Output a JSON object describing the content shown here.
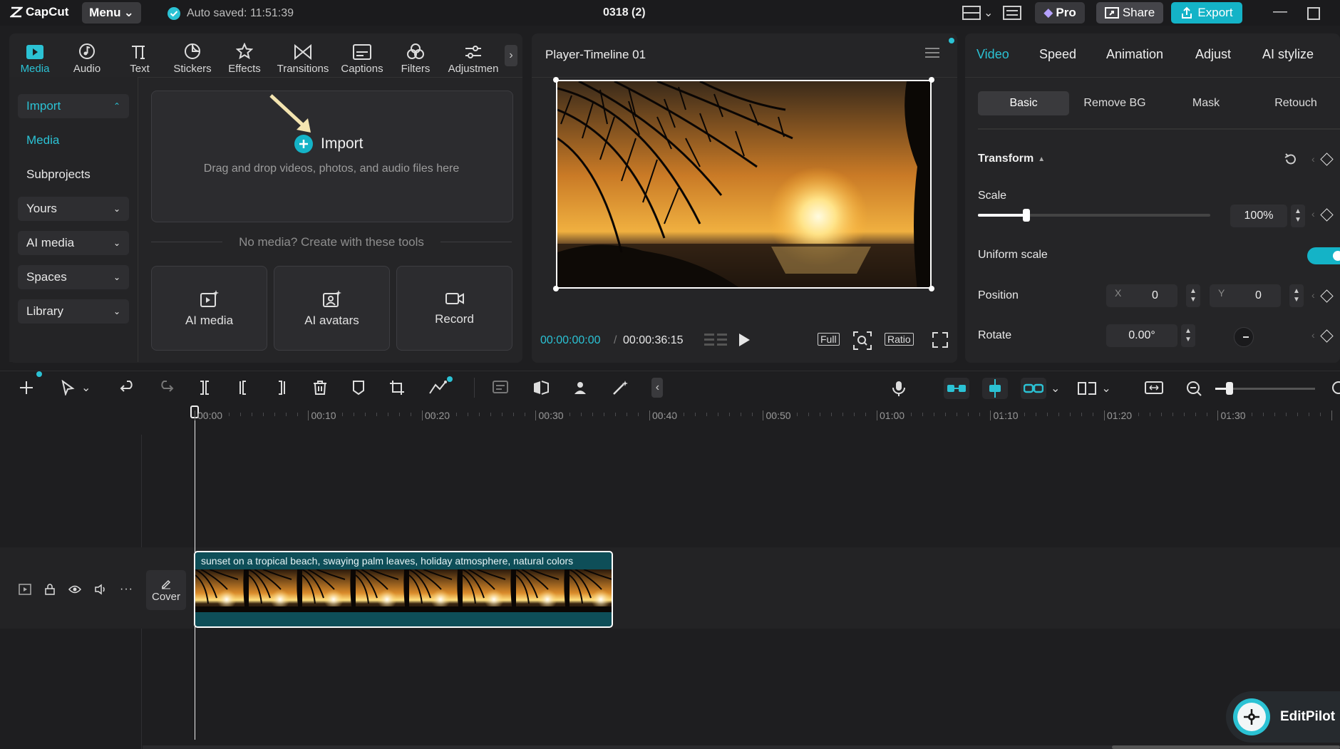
{
  "app": {
    "name": "CapCut",
    "menu_label": "Menu",
    "autosave": "Auto saved: 11:51:39",
    "project_title": "0318 (2)"
  },
  "titlebar": {
    "pro_label": "Pro",
    "share_label": "Share",
    "export_label": "Export"
  },
  "tool_tabs": [
    {
      "label": "Media",
      "icon": "media-icon"
    },
    {
      "label": "Audio",
      "icon": "audio-icon"
    },
    {
      "label": "Text",
      "icon": "text-icon"
    },
    {
      "label": "Stickers",
      "icon": "stickers-icon"
    },
    {
      "label": "Effects",
      "icon": "effects-icon"
    },
    {
      "label": "Transitions",
      "icon": "transitions-icon"
    },
    {
      "label": "Captions",
      "icon": "captions-icon"
    },
    {
      "label": "Filters",
      "icon": "filters-icon"
    },
    {
      "label": "Adjustmen",
      "icon": "adjustment-icon"
    }
  ],
  "sidebar": {
    "items": [
      {
        "label": "Import"
      },
      {
        "label": "Media"
      },
      {
        "label": "Subprojects"
      },
      {
        "label": "Yours"
      },
      {
        "label": "AI media"
      },
      {
        "label": "Spaces"
      },
      {
        "label": "Library"
      }
    ]
  },
  "import_zone": {
    "title": "Import",
    "hint": "Drag and drop videos, photos, and audio files here"
  },
  "tools_divider": "No media? Create with these tools",
  "tool_cards": [
    {
      "label": "AI media"
    },
    {
      "label": "AI avatars"
    },
    {
      "label": "Record"
    }
  ],
  "player": {
    "title": "Player-Timeline 01",
    "current_time": "00:00:00:00",
    "separator": "/",
    "duration": "00:00:36:15",
    "full_label": "Full",
    "ratio_label": "Ratio"
  },
  "props": {
    "tabs": [
      "Video",
      "Speed",
      "Animation",
      "Adjust",
      "AI stylize"
    ],
    "subtabs": [
      "Basic",
      "Remove BG",
      "Mask",
      "Retouch"
    ],
    "transform_label": "Transform",
    "scale_label": "Scale",
    "scale_value": "100%",
    "scale_fraction": 0.21,
    "uniform_label": "Uniform scale",
    "position_label": "Position",
    "x_label": "X",
    "x_value": "0",
    "y_label": "Y",
    "y_value": "0",
    "rotate_label": "Rotate",
    "rotate_value": "0.00°"
  },
  "timeline": {
    "ticks": [
      "00:00",
      "00:10",
      "00:20",
      "00:30",
      "00:40",
      "00:50",
      "01:00",
      "01:10",
      "01:20",
      "01:30"
    ],
    "cover_label": "Cover",
    "clip_caption": "sunset on a tropical beach, swaying palm leaves, holiday atmosphere, natural colors"
  },
  "editpilot": {
    "label": "EditPilot"
  },
  "colors": {
    "accent": "#14b3c7",
    "accent_text": "#2bc2d4",
    "bg": "#1e1e20",
    "panel": "#252527"
  }
}
